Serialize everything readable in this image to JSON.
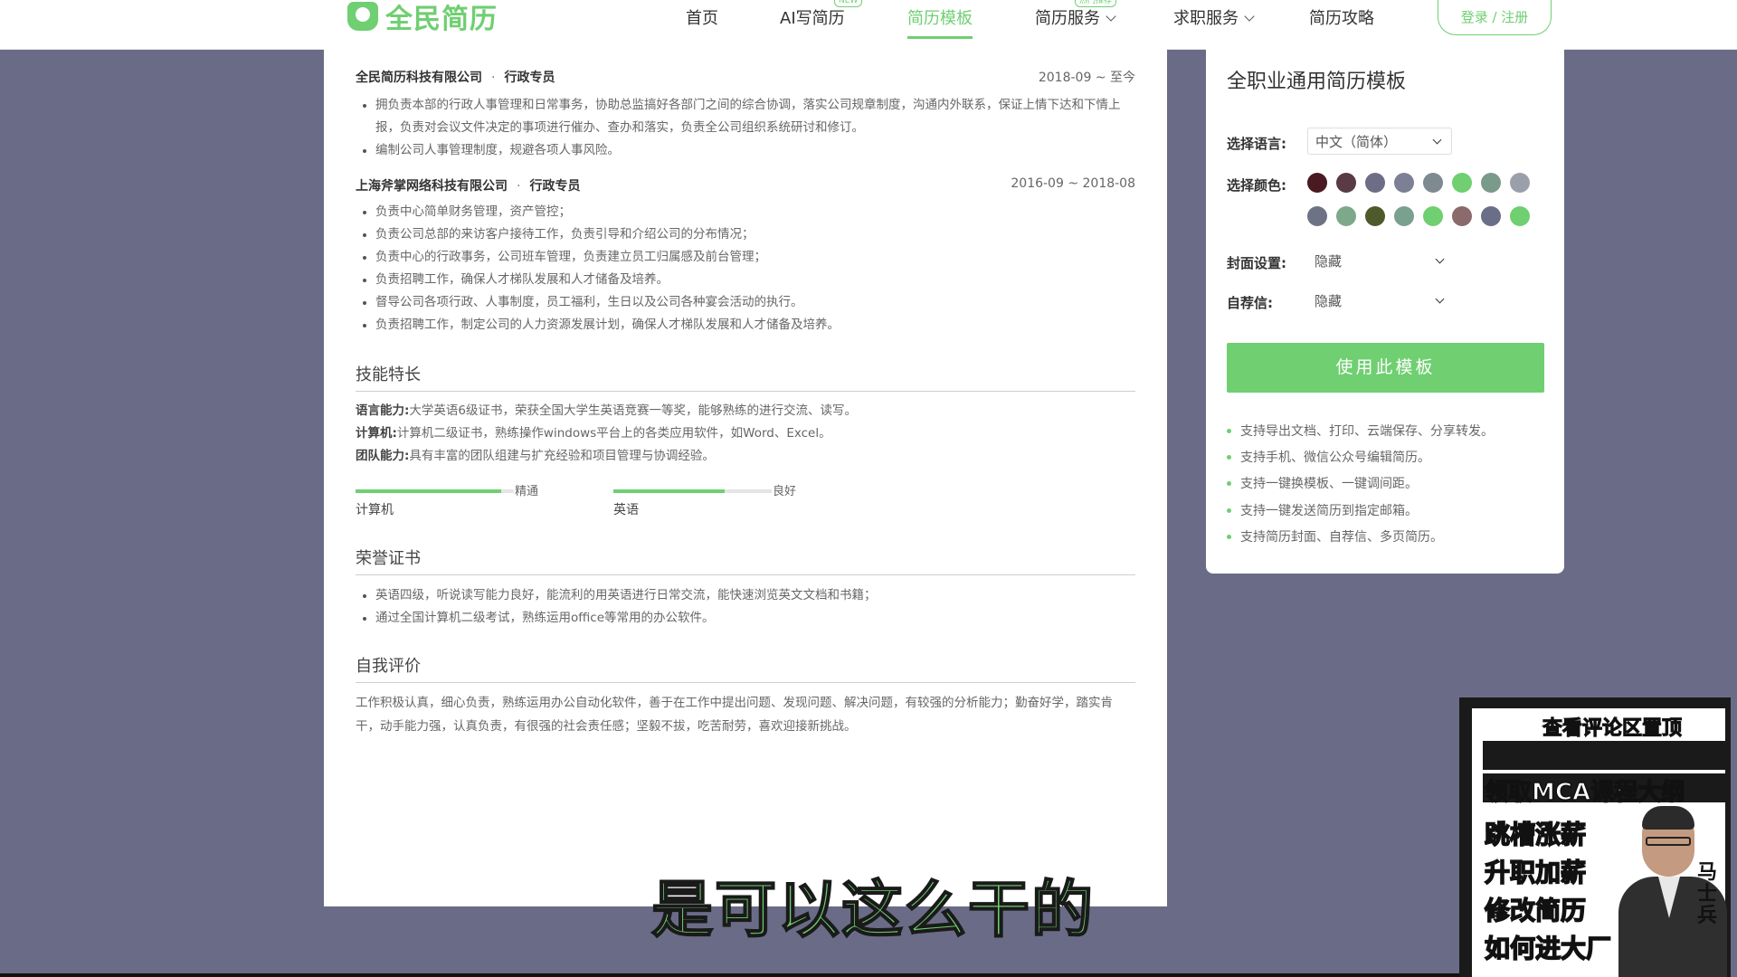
{
  "nav": {
    "logo": "全民简历",
    "items": [
      {
        "label": "首页",
        "badge": ""
      },
      {
        "label": "AI写简历",
        "badge": "NEW"
      },
      {
        "label": "简历模板",
        "badge": ""
      },
      {
        "label": "简历服务",
        "badge": "热门推荐"
      },
      {
        "label": "求职服务",
        "badge": ""
      },
      {
        "label": "简历攻略",
        "badge": ""
      }
    ],
    "active_index": 2,
    "login": "登录 / 注册"
  },
  "resume": {
    "jobs": [
      {
        "company": "全民简历科技有限公司",
        "role": "行政专员",
        "date": "2018-09 ~ 至今",
        "bullets": [
          "拥负责本部的行政人事管理和日常事务，协助总监搞好各部门之间的综合协调，落实公司规章制度，沟通内外联系，保证上情下达和下情上报，负责对会议文件决定的事项进行催办、查办和落实，负责全公司组织系统研讨和修订。",
          "编制公司人事管理制度，规避各项人事风险。"
        ]
      },
      {
        "company": "上海斧掌网络科技有限公司",
        "role": "行政专员",
        "date": "2016-09 ~ 2018-08",
        "bullets": [
          "负责中心简单财务管理，资产管控；",
          "负责公司总部的来访客户接待工作，负责引导和介绍公司的分布情况；",
          "负责中心的行政事务，公司班车管理，负责建立员工归属感及前台管理；",
          "负责招聘工作，确保人才梯队发展和人才储备及培养。",
          "督导公司各项行政、人事制度，员工福利，生日以及公司各种宴会活动的执行。",
          "负责招聘工作，制定公司的人力资源发展计划，确保人才梯队发展和人才储备及培养。"
        ]
      }
    ],
    "skills": {
      "title": "技能特长",
      "lines": [
        {
          "label": "语言能力:",
          "text": "大学英语6级证书，荣获全国大学生英语竞赛一等奖，能够熟练的进行交流、读写。"
        },
        {
          "label": "计算机:",
          "text": "计算机二级证书，熟练操作windows平台上的各类应用软件，如Word、Excel。"
        },
        {
          "label": "团队能力:",
          "text": "具有丰富的团队组建与扩充经验和项目管理与协调经验。"
        }
      ],
      "bars": [
        {
          "name": "计算机",
          "level": "精通",
          "fill_pct": 92
        },
        {
          "name": "英语",
          "level": "良好",
          "fill_pct": 70
        }
      ]
    },
    "honors": {
      "title": "荣誉证书",
      "bullets": [
        "英语四级，听说读写能力良好，能流利的用英语进行日常交流，能快速浏览英文文档和书籍；",
        "通过全国计算机二级考试，熟练运用office等常用的办公软件。"
      ]
    },
    "self_eval": {
      "title": "自我评价",
      "text": "工作积极认真，细心负责，熟练运用办公自动化软件，善于在工作中提出问题、发现问题、解决问题，有较强的分析能力；勤奋好学，踏实肯干，动手能力强，认真负责，有很强的社会责任感；坚毅不拔，吃苦耐劳，喜欢迎接新挑战。"
    }
  },
  "panel": {
    "title": "全职业通用简历模板",
    "language_label": "选择语言:",
    "language_value": "中文（简体）",
    "color_label": "选择颜色:",
    "colors_row1": [
      "#4a1a22",
      "#5a3a44",
      "#6d6e86",
      "#7d8094",
      "#7e8a92",
      "#6fcf71",
      "#7a9a8a",
      "#9aa0aa"
    ],
    "colors_row2": [
      "#6d7384",
      "#7ea88a",
      "#4f5a2a",
      "#7aa090",
      "#6fcf71",
      "#8a6a6a",
      "#6a6e86",
      "#6fcf71"
    ],
    "cover_label": "封面设置:",
    "cover_value": "隐藏",
    "letter_label": "自荐信:",
    "letter_value": "隐藏",
    "use_button": "使用此模板",
    "features": [
      "支持导出文档、打印、云端保存、分享转发。",
      "支持手机、微信公众号编辑简历。",
      "支持一键换模板、一键调间距。",
      "支持一键发送简历到指定邮箱。",
      "支持简历封面、自荐信、多页简历。"
    ]
  },
  "subtitle": "是可以这么干的",
  "promo": {
    "top": "查看评论区置顶",
    "line2": "领取MCA课程大纲",
    "lines": [
      "跳槽涨薪",
      "升职加薪",
      "修改简历",
      "如何进大厂"
    ],
    "vertical": "马士兵"
  }
}
